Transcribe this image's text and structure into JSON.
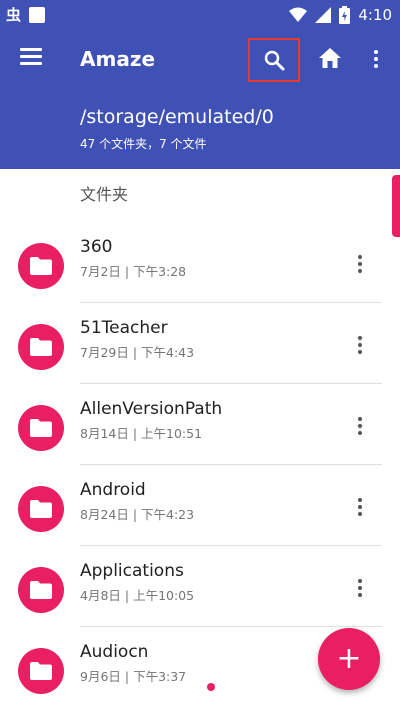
{
  "status_bar": {
    "left_glyph": "虫",
    "time": "4:10"
  },
  "toolbar": {
    "title": "Amaze"
  },
  "path": {
    "current": "/storage/emulated/0",
    "summary": "47 个文件夹，7 个文件"
  },
  "list": {
    "section_header": "文件夹",
    "items": [
      {
        "name": "360",
        "meta": "7月2日 | 下午3:28"
      },
      {
        "name": "51Teacher",
        "meta": "7月29日 | 下午4:43"
      },
      {
        "name": "AllenVersionPath",
        "meta": "8月14日 | 上午10:51"
      },
      {
        "name": "Android",
        "meta": "8月24日 | 下午4:23"
      },
      {
        "name": "Applications",
        "meta": "4月8日 | 上午10:05"
      },
      {
        "name": "Audiocn",
        "meta": "9月6日 | 下午3:37"
      }
    ]
  },
  "fab": {
    "label": "+"
  },
  "colors": {
    "primary": "#3f51b5",
    "accent": "#e91e63",
    "highlight_box": "#e53935"
  },
  "icons": [
    "menu-icon",
    "search-icon",
    "home-icon",
    "more-vert-icon",
    "folder-icon",
    "add-icon",
    "wifi-icon",
    "signal-icon",
    "battery-icon"
  ]
}
